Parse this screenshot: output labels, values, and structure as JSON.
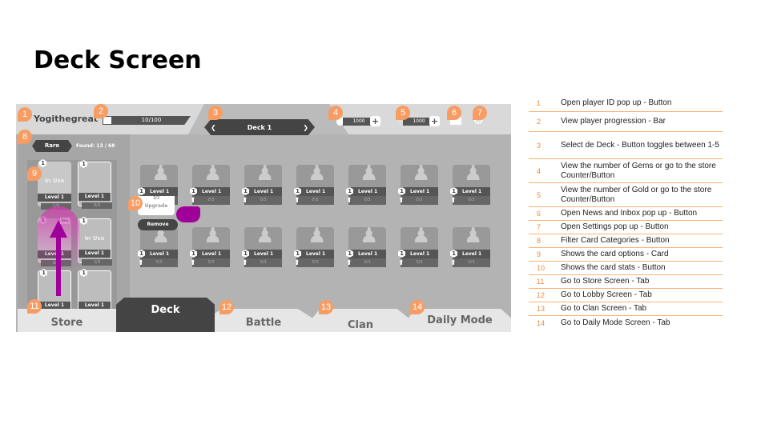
{
  "title": "Deck Screen",
  "colors": {
    "badge": "#f79c63",
    "dark": "#444444",
    "highlight": "#a0009a"
  },
  "topbar": {
    "player_name": "Yogithegreat",
    "progress_label": "10/100",
    "progress": 0.1,
    "deck_label": "Deck 1",
    "prev_icon": "chevron-left-icon",
    "next_icon": "chevron-right-icon",
    "gems": "1000",
    "gold": "1000"
  },
  "filter": {
    "label": "Rare",
    "found": "Found: 13 / 68"
  },
  "collection": [
    {
      "level": "Level 1",
      "progress": "1/3",
      "in_use": "In Use",
      "hex": "1"
    },
    {
      "level": "Level 1",
      "progress": "0/3",
      "in_use": "",
      "hex": "1"
    },
    {
      "level": "Level 1",
      "progress": "0/3",
      "in_use": "",
      "hex": "1",
      "new": "New"
    },
    {
      "level": "Level 1",
      "progress": "1/3",
      "in_use": "In Use",
      "hex": "1"
    },
    {
      "level": "Level 1",
      "progress": "",
      "in_use": "",
      "hex": "1"
    },
    {
      "level": "Level 1",
      "progress": "",
      "in_use": "",
      "hex": "1"
    }
  ],
  "deck_cards": [
    {
      "level": "Level 1",
      "progress": "0/3"
    },
    {
      "level": "Level 1",
      "progress": "0/3"
    },
    {
      "level": "Level 1",
      "progress": "0/3"
    },
    {
      "level": "Level 1",
      "progress": "0/3"
    },
    {
      "level": "Level 1",
      "progress": "0/3"
    },
    {
      "level": "Level 1",
      "progress": "0/3"
    },
    {
      "level": "Level 1",
      "progress": "0/3"
    },
    {
      "level": "Level 1",
      "progress": "0/3"
    },
    {
      "level": "Level 1",
      "progress": "0/3"
    },
    {
      "level": "Level 1",
      "progress": "0/3"
    },
    {
      "level": "Level 1",
      "progress": "0/3"
    },
    {
      "level": "Level 1",
      "progress": "0/3"
    },
    {
      "level": "Level 1",
      "progress": "0/3"
    },
    {
      "level": "Level 1",
      "progress": "0/3"
    }
  ],
  "card_popup": {
    "progress": "3/3",
    "upgrade": "Upgrade",
    "remove": "Remove"
  },
  "tabs": [
    {
      "label": "Store"
    },
    {
      "label": "Deck",
      "active": true
    },
    {
      "label": "Battle"
    },
    {
      "label": "Clan"
    },
    {
      "label": "Daily Mode"
    }
  ],
  "badges": [
    "1",
    "2",
    "3",
    "4",
    "5",
    "6",
    "7",
    "8",
    "9",
    "10",
    "11",
    "12",
    "13",
    "14"
  ],
  "legend": [
    {
      "n": "1",
      "text": "Open player ID pop up - Button"
    },
    {
      "n": "2",
      "text": "View player progression - Bar"
    },
    {
      "n": "3",
      "text": "Select de Deck - Button toggles between 1-5"
    },
    {
      "n": "4",
      "text": "View the number of Gems or go to the store Counter/Button"
    },
    {
      "n": "5",
      "text": "View the number of Gold or go to the store Counter/Button"
    },
    {
      "n": "6",
      "text": "Open News and Inbox pop up - Button"
    },
    {
      "n": "7",
      "text": "Open Settings pop up - Button"
    },
    {
      "n": "8",
      "text": "Filter Card Categories - Button"
    },
    {
      "n": "9",
      "text": "Shows the card options - Card"
    },
    {
      "n": "10",
      "text": "Shows the card stats - Button"
    },
    {
      "n": "11",
      "text": "Go to Store Screen - Tab"
    },
    {
      "n": "12",
      "text": "Go to Lobby Screen - Tab"
    },
    {
      "n": "13",
      "text": "Go to Clan Screen - Tab"
    },
    {
      "n": "14",
      "text": "Go to Daily Mode Screen - Tab"
    }
  ]
}
